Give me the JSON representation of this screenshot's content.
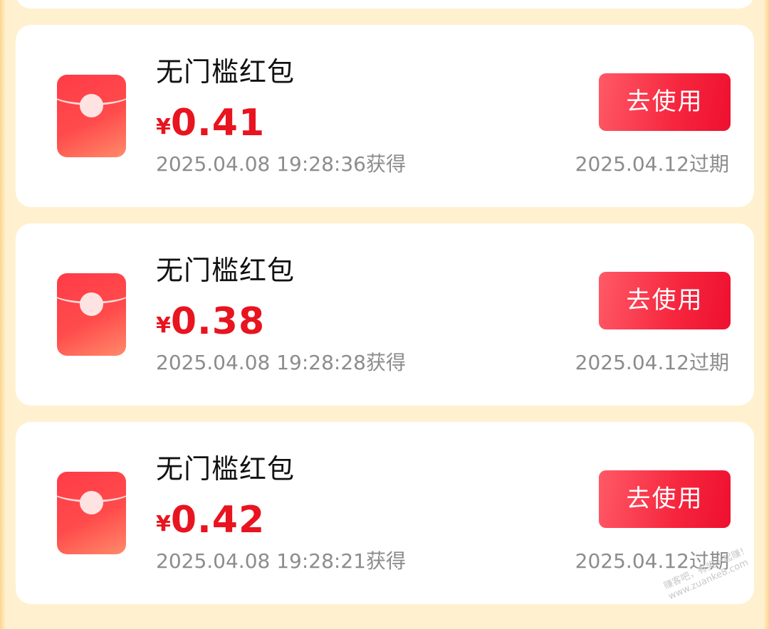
{
  "coupons": [
    {
      "title": "无门槛红包",
      "currency": "¥",
      "amount": "0.41",
      "obtained": "2025.04.08 19:28:36获得",
      "expires": "2025.04.12过期",
      "button_label": "去使用"
    },
    {
      "title": "无门槛红包",
      "currency": "¥",
      "amount": "0.38",
      "obtained": "2025.04.08 19:28:28获得",
      "expires": "2025.04.12过期",
      "button_label": "去使用"
    },
    {
      "title": "无门槛红包",
      "currency": "¥",
      "amount": "0.42",
      "obtained": "2025.04.08 19:28:21获得",
      "expires": "2025.04.12过期",
      "button_label": "去使用"
    }
  ],
  "watermark": {
    "line1": "赚客吧，有奖一起赚！",
    "line2": "www.zuanke8.com"
  },
  "colors": {
    "amount": "#e8141f",
    "button": "#f6253d",
    "background": "#fff1d0"
  },
  "icons": {
    "coupon_icon": "red-envelope-icon"
  }
}
